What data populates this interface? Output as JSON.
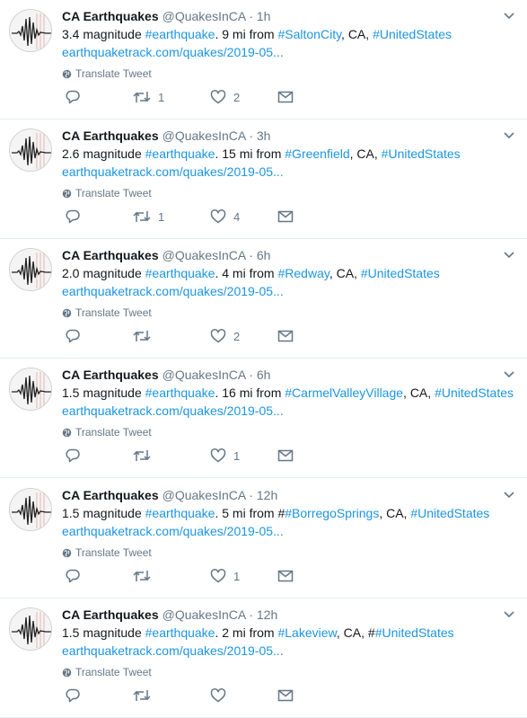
{
  "colors": {
    "link": "#1b95e0",
    "muted": "#657786",
    "text": "#14171a",
    "divider": "#e6ecf0"
  },
  "translate_label": "Translate Tweet",
  "icons": {
    "reply": "reply-icon",
    "retweet": "retweet-icon",
    "like": "heart-icon",
    "dm": "envelope-icon",
    "caret": "chevron-down-icon",
    "globe": "globe-icon"
  },
  "tweets": [
    {
      "name": "CA Earthquakes",
      "handle": "@QuakesInCA",
      "sep": "·",
      "time": "1h",
      "mag": "3.4 magnitude ",
      "tag": "#earthquake",
      "dist": ". 9 mi from ",
      "place": "#SaltonCity",
      "state": ", CA, ",
      "country_prefix": "",
      "country": "#UnitedStates",
      "link": "earthquaketrack.com/quakes/2019-05...",
      "retweets": "1",
      "likes": "2"
    },
    {
      "name": "CA Earthquakes",
      "handle": "@QuakesInCA",
      "sep": "·",
      "time": "3h",
      "mag": "2.6 magnitude ",
      "tag": "#earthquake",
      "dist": ". 15 mi from ",
      "place": "#Greenfield",
      "state": ", CA, ",
      "country_prefix": "",
      "country": "#UnitedStates",
      "link": "earthquaketrack.com/quakes/2019-05...",
      "retweets": "1",
      "likes": "4"
    },
    {
      "name": "CA Earthquakes",
      "handle": "@QuakesInCA",
      "sep": "·",
      "time": "6h",
      "mag": "2.0 magnitude ",
      "tag": "#earthquake",
      "dist": ". 4 mi from ",
      "place": "#Redway",
      "state": ", CA, ",
      "country_prefix": "",
      "country": "#UnitedStates",
      "link": "earthquaketrack.com/quakes/2019-05...",
      "retweets": "",
      "likes": "2"
    },
    {
      "name": "CA Earthquakes",
      "handle": "@QuakesInCA",
      "sep": "·",
      "time": "6h",
      "mag": "1.5 magnitude ",
      "tag": "#earthquake",
      "dist": ". 16 mi from ",
      "place": "#CarmelValleyVillage",
      "state": ", CA, ",
      "country_prefix": "",
      "country": "#UnitedStates",
      "link": "earthquaketrack.com/quakes/2019-05...",
      "retweets": "",
      "likes": "1"
    },
    {
      "name": "CA Earthquakes",
      "handle": "@QuakesInCA",
      "sep": "·",
      "time": "12h",
      "mag": "1.5 magnitude ",
      "tag": "#earthquake",
      "dist": ". 5 mi from #",
      "place": "#BorregoSprings",
      "state": ", CA, ",
      "country_prefix": "",
      "country": "#UnitedStates",
      "link": "earthquaketrack.com/quakes/2019-05...",
      "retweets": "",
      "likes": "1"
    },
    {
      "name": "CA Earthquakes",
      "handle": "@QuakesInCA",
      "sep": "·",
      "time": "12h",
      "mag": "1.5 magnitude ",
      "tag": "#earthquake",
      "dist": ". 2 mi from ",
      "place": "#Lakeview",
      "state": ", CA, ",
      "country_prefix": "#",
      "country": "#UnitedStates",
      "link": "earthquaketrack.com/quakes/2019-05...",
      "retweets": "",
      "likes": ""
    }
  ]
}
